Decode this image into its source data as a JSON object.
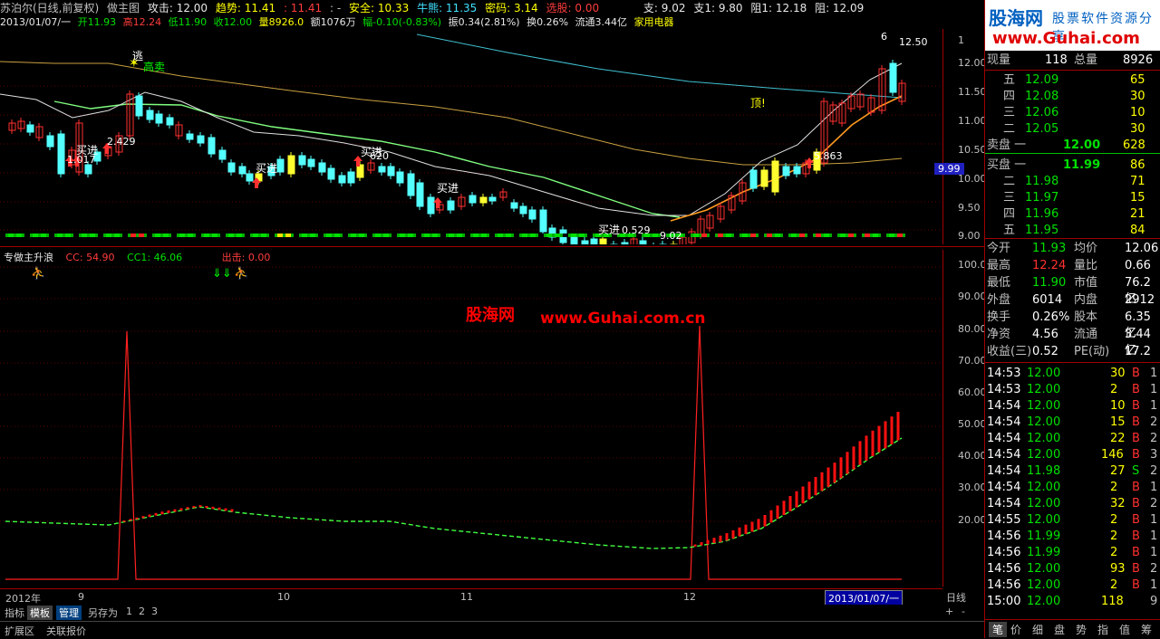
{
  "header": {
    "stock": "苏泊尔(日线,前复权)",
    "formula": "做主图",
    "attack": "攻击: 12.00",
    "trend": "趋势: 11.41",
    "trend2": ": 11.41",
    "dash": ": -",
    "safe": "安全: 10.33",
    "bull": "牛熊: 11.35",
    "code": "密码: 3.14",
    "pick": "选股: 0.00",
    "support": "支: 9.02",
    "support1": "支1: 9.80",
    "resist1": "阻1: 12.18",
    "resist": "阻: 12.09"
  },
  "subheader": {
    "date": "2013/01/07/一",
    "open": "开11.93",
    "high": "高12.24",
    "low": "低11.90",
    "close": "收12.00",
    "vol": "量8926.0",
    "amount": "额1076万",
    "change": "幅-0.10(-0.83%)",
    "amp": "振0.34(2.81%)",
    "turnover": "换0.26%",
    "float": "流通3.44亿",
    "sector": "家用电器"
  },
  "price_axis": [
    "12.00",
    "11.50",
    "11.00",
    "10.50",
    "10.00",
    "9.50",
    "9.00"
  ],
  "price_axis_top": "1",
  "price_axis_marker": "9.99",
  "chart_annotations": {
    "escape": "逃",
    "high_sell": "高卖",
    "top": "顶!",
    "buy": "买进",
    "v_2429": "2.429",
    "v_1017": "1.017",
    "v_620": "620",
    "v_5863": "5.863",
    "v_0529": "0.529",
    "v_902": "9.02",
    "v_1250": "12.50",
    "v_6": "6"
  },
  "indicator": {
    "name": "专做主升浪",
    "cc": "CC: 54.90",
    "cc1": "CC1: 46.06",
    "exit": "出击: 0.00"
  },
  "ind_axis": [
    "100.0",
    "90.00",
    "80.00",
    "70.00",
    "60.00",
    "50.00",
    "40.00",
    "30.00",
    "20.00"
  ],
  "watermark": {
    "cn": "股海网",
    "url": "www.Guhai.com.cn"
  },
  "date_axis": {
    "year": "2012年",
    "m9": "9",
    "m10": "10",
    "m11": "11",
    "m12": "12",
    "current": "2013/01/07/一"
  },
  "period": "日线",
  "bottom_tabs": [
    "指标",
    "模板",
    "管理",
    "另存为",
    "1",
    "2",
    "3"
  ],
  "status_bar": [
    "扩展区",
    "关联报价"
  ],
  "logo": {
    "brand": "股海网",
    "slogan": "股票软件资源分享",
    "url": "www.Guhai.com"
  },
  "quote": {
    "now_label": "现量",
    "now_val": "118",
    "total_label": "总量",
    "total_val": "8926",
    "sell": [
      {
        "lvl": "五",
        "price": "12.09",
        "vol": "65"
      },
      {
        "lvl": "四",
        "price": "12.08",
        "vol": "30"
      },
      {
        "lvl": "三",
        "price": "12.06",
        "vol": "10"
      },
      {
        "lvl": "二",
        "price": "12.05",
        "vol": "30"
      },
      {
        "lvl": "卖盘 一",
        "price": "12.00",
        "vol": "628"
      }
    ],
    "buy": [
      {
        "lvl": "买盘 一",
        "price": "11.99",
        "vol": "86"
      },
      {
        "lvl": "二",
        "price": "11.98",
        "vol": "71"
      },
      {
        "lvl": "三",
        "price": "11.97",
        "vol": "15"
      },
      {
        "lvl": "四",
        "price": "11.96",
        "vol": "21"
      },
      {
        "lvl": "五",
        "price": "11.95",
        "vol": "84"
      }
    ],
    "stats": [
      {
        "l1": "今开",
        "v1": "11.93",
        "l2": "均价",
        "v2": "12.06"
      },
      {
        "l1": "最高",
        "v1": "12.24",
        "l2": "量比",
        "v2": "0.66"
      },
      {
        "l1": "最低",
        "v1": "11.90",
        "l2": "市值",
        "v2": "76.2亿"
      },
      {
        "l1": "外盘",
        "v1": "6014",
        "l2": "内盘",
        "v2": "2912"
      },
      {
        "l1": "换手",
        "v1": "0.26%",
        "l2": "股本",
        "v2": "6.35亿"
      },
      {
        "l1": "净资",
        "v1": "4.56",
        "l2": "流通",
        "v2": "3.44亿"
      },
      {
        "l1": "收益(三)",
        "v1": "0.52",
        "l2": "PE(动)",
        "v2": "17.2"
      }
    ],
    "ticks": [
      {
        "t": "14:53",
        "p": "12.00",
        "v": "30",
        "s": "B",
        "n": "1"
      },
      {
        "t": "14:53",
        "p": "12.00",
        "v": "2",
        "s": "B",
        "n": "1"
      },
      {
        "t": "14:54",
        "p": "12.00",
        "v": "10",
        "s": "B",
        "n": "1"
      },
      {
        "t": "14:54",
        "p": "12.00",
        "v": "15",
        "s": "B",
        "n": "2"
      },
      {
        "t": "14:54",
        "p": "12.00",
        "v": "22",
        "s": "B",
        "n": "2"
      },
      {
        "t": "14:54",
        "p": "12.00",
        "v": "146",
        "s": "B",
        "n": "3"
      },
      {
        "t": "14:54",
        "p": "11.98",
        "v": "27",
        "s": "S",
        "n": "2"
      },
      {
        "t": "14:54",
        "p": "12.00",
        "v": "2",
        "s": "B",
        "n": "1"
      },
      {
        "t": "14:54",
        "p": "12.00",
        "v": "32",
        "s": "B",
        "n": "2"
      },
      {
        "t": "14:55",
        "p": "12.00",
        "v": "2",
        "s": "B",
        "n": "1"
      },
      {
        "t": "14:56",
        "p": "11.99",
        "v": "2",
        "s": "B",
        "n": "1"
      },
      {
        "t": "14:56",
        "p": "11.99",
        "v": "2",
        "s": "B",
        "n": "1"
      },
      {
        "t": "14:56",
        "p": "12.00",
        "v": "93",
        "s": "B",
        "n": "2"
      },
      {
        "t": "14:56",
        "p": "12.00",
        "v": "2",
        "s": "B",
        "n": "1"
      },
      {
        "t": "15:00",
        "p": "12.00",
        "v": "118",
        "s": "",
        "n": "9"
      }
    ],
    "tabs": [
      "笔",
      "价",
      "细",
      "盘",
      "势",
      "指",
      "值",
      "筹"
    ]
  }
}
